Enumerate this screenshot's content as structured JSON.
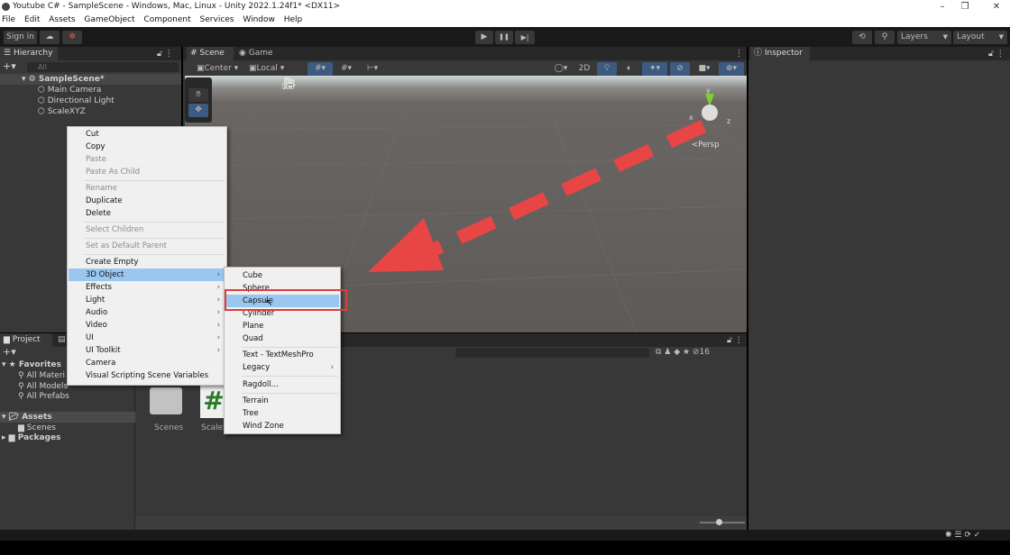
{
  "window": {
    "title": "Youtube C# - SampleScene - Windows, Mac, Linux - Unity 2022.1.24f1* <DX11>",
    "controls": [
      "–",
      "❐",
      "✕"
    ]
  },
  "menubar": [
    "File",
    "Edit",
    "Assets",
    "GameObject",
    "Component",
    "Services",
    "Window",
    "Help"
  ],
  "toolbar": {
    "sign_in": "Sign in",
    "layers": "Layers",
    "layout": "Layout",
    "play": "▶",
    "pause": "❚❚",
    "step": "▶|"
  },
  "hierarchy": {
    "tab": "Hierarchy",
    "search_placeholder": "All",
    "scene": "SampleScene*",
    "objects": [
      "Main Camera",
      "Directional Light",
      "ScaleXYZ"
    ]
  },
  "scene": {
    "tabs": [
      "Scene",
      "Game"
    ],
    "pivot": "Center",
    "space": "Local",
    "mode2d": "2D",
    "persp": "<Persp",
    "gizmo_axes": [
      "y",
      "x",
      "z"
    ]
  },
  "inspector": {
    "tab": "Inspector"
  },
  "context_menu": {
    "items": [
      {
        "label": "Cut"
      },
      {
        "label": "Copy"
      },
      {
        "label": "Paste",
        "disabled": true
      },
      {
        "label": "Paste As Child",
        "disabled": true
      },
      {
        "label": "Rename",
        "disabled": true
      },
      {
        "label": "Duplicate"
      },
      {
        "label": "Delete"
      },
      {
        "label": "Select Children",
        "disabled": true
      },
      {
        "label": "Set as Default Parent",
        "disabled": true
      },
      {
        "label": "Create Empty"
      },
      {
        "label": "3D Object",
        "submenu": true,
        "highlighted": true
      },
      {
        "label": "Effects",
        "submenu": true
      },
      {
        "label": "Light",
        "submenu": true
      },
      {
        "label": "Audio",
        "submenu": true
      },
      {
        "label": "Video",
        "submenu": true
      },
      {
        "label": "UI",
        "submenu": true
      },
      {
        "label": "UI Toolkit",
        "submenu": true
      },
      {
        "label": "Camera"
      },
      {
        "label": "Visual Scripting Scene Variables"
      }
    ]
  },
  "submenu": {
    "items": [
      {
        "label": "Cube"
      },
      {
        "label": "Sphere"
      },
      {
        "label": "Capsule",
        "highlighted": true
      },
      {
        "label": "Cylinder"
      },
      {
        "label": "Plane"
      },
      {
        "label": "Quad"
      },
      {
        "label": "Text - TextMeshPro"
      },
      {
        "label": "Legacy",
        "submenu": true
      },
      {
        "label": "Ragdoll..."
      },
      {
        "label": "Terrain"
      },
      {
        "label": "Tree"
      },
      {
        "label": "Wind Zone"
      }
    ]
  },
  "project": {
    "tab": "Project",
    "favorites": "Favorites",
    "favorite_items": [
      "All Materi",
      "All Models",
      "All Prefabs"
    ],
    "assets": "Assets",
    "asset_children": [
      "Scenes"
    ],
    "packages": "Packages",
    "grid_items": [
      "Scenes",
      "ScaleX"
    ],
    "hidden_count": "16",
    "script_glyph": "#"
  },
  "colors": {
    "highlight_box": "#e03c3c",
    "arrow": "#e84545",
    "menu_highlight": "#99c7f0"
  }
}
